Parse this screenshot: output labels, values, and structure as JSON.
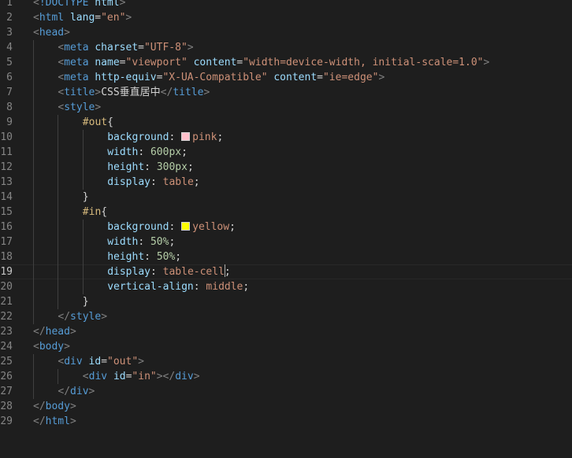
{
  "colors": {
    "background": "#1e1e1e",
    "line_number": "#858585",
    "tag": "#569cd6",
    "attribute": "#9cdcfe",
    "string": "#ce9178",
    "selector": "#d7ba7d",
    "number": "#b5cea8",
    "bracket": "#808080",
    "text": "#d4d4d4"
  },
  "current_line": 19,
  "lines": [
    {
      "n": "1",
      "indent": 0,
      "tokens": [
        {
          "c": "bracket",
          "t": "<"
        },
        {
          "c": "tag",
          "t": "!DOCTYPE"
        },
        {
          "c": "text",
          "t": " "
        },
        {
          "c": "attr",
          "t": "html"
        },
        {
          "c": "bracket",
          "t": ">"
        }
      ]
    },
    {
      "n": "2",
      "indent": 0,
      "tokens": [
        {
          "c": "bracket",
          "t": "<"
        },
        {
          "c": "tag",
          "t": "html"
        },
        {
          "c": "text",
          "t": " "
        },
        {
          "c": "attr",
          "t": "lang"
        },
        {
          "c": "text",
          "t": "="
        },
        {
          "c": "str",
          "t": "\"en\""
        },
        {
          "c": "bracket",
          "t": ">"
        }
      ]
    },
    {
      "n": "3",
      "indent": 0,
      "tokens": [
        {
          "c": "bracket",
          "t": "<"
        },
        {
          "c": "tag",
          "t": "head"
        },
        {
          "c": "bracket",
          "t": ">"
        }
      ]
    },
    {
      "n": "4",
      "indent": 1,
      "tokens": [
        {
          "c": "bracket",
          "t": "<"
        },
        {
          "c": "tag",
          "t": "meta"
        },
        {
          "c": "text",
          "t": " "
        },
        {
          "c": "attr",
          "t": "charset"
        },
        {
          "c": "text",
          "t": "="
        },
        {
          "c": "str",
          "t": "\"UTF-8\""
        },
        {
          "c": "bracket",
          "t": ">"
        }
      ]
    },
    {
      "n": "5",
      "indent": 1,
      "tokens": [
        {
          "c": "bracket",
          "t": "<"
        },
        {
          "c": "tag",
          "t": "meta"
        },
        {
          "c": "text",
          "t": " "
        },
        {
          "c": "attr",
          "t": "name"
        },
        {
          "c": "text",
          "t": "="
        },
        {
          "c": "str",
          "t": "\"viewport\""
        },
        {
          "c": "text",
          "t": " "
        },
        {
          "c": "attr",
          "t": "content"
        },
        {
          "c": "text",
          "t": "="
        },
        {
          "c": "str",
          "t": "\"width=device-width, initial-scale=1.0\""
        },
        {
          "c": "bracket",
          "t": ">"
        }
      ]
    },
    {
      "n": "6",
      "indent": 1,
      "tokens": [
        {
          "c": "bracket",
          "t": "<"
        },
        {
          "c": "tag",
          "t": "meta"
        },
        {
          "c": "text",
          "t": " "
        },
        {
          "c": "attr",
          "t": "http-equiv"
        },
        {
          "c": "text",
          "t": "="
        },
        {
          "c": "str",
          "t": "\"X-UA-Compatible\""
        },
        {
          "c": "text",
          "t": " "
        },
        {
          "c": "attr",
          "t": "content"
        },
        {
          "c": "text",
          "t": "="
        },
        {
          "c": "str",
          "t": "\"ie=edge\""
        },
        {
          "c": "bracket",
          "t": ">"
        }
      ]
    },
    {
      "n": "7",
      "indent": 1,
      "tokens": [
        {
          "c": "bracket",
          "t": "<"
        },
        {
          "c": "tag",
          "t": "title"
        },
        {
          "c": "bracket",
          "t": ">"
        },
        {
          "c": "text",
          "t": "CSS垂直居中"
        },
        {
          "c": "bracket",
          "t": "</"
        },
        {
          "c": "tag",
          "t": "title"
        },
        {
          "c": "bracket",
          "t": ">"
        }
      ]
    },
    {
      "n": "8",
      "indent": 1,
      "tokens": [
        {
          "c": "bracket",
          "t": "<"
        },
        {
          "c": "tag",
          "t": "style"
        },
        {
          "c": "bracket",
          "t": ">"
        }
      ]
    },
    {
      "n": "9",
      "indent": 2,
      "tokens": [
        {
          "c": "sel",
          "t": "#out"
        },
        {
          "c": "punc",
          "t": "{"
        }
      ]
    },
    {
      "n": "10",
      "indent": 3,
      "tokens": [
        {
          "c": "prop",
          "t": "background"
        },
        {
          "c": "punc",
          "t": ": "
        },
        {
          "c": "swatch",
          "t": "",
          "color": "#ffc0cb"
        },
        {
          "c": "val",
          "t": "pink"
        },
        {
          "c": "punc",
          "t": ";"
        }
      ]
    },
    {
      "n": "11",
      "indent": 3,
      "tokens": [
        {
          "c": "prop",
          "t": "width"
        },
        {
          "c": "punc",
          "t": ": "
        },
        {
          "c": "num",
          "t": "600px"
        },
        {
          "c": "punc",
          "t": ";"
        }
      ]
    },
    {
      "n": "12",
      "indent": 3,
      "tokens": [
        {
          "c": "prop",
          "t": "height"
        },
        {
          "c": "punc",
          "t": ": "
        },
        {
          "c": "num",
          "t": "300px"
        },
        {
          "c": "punc",
          "t": ";"
        }
      ]
    },
    {
      "n": "13",
      "indent": 3,
      "tokens": [
        {
          "c": "prop",
          "t": "display"
        },
        {
          "c": "punc",
          "t": ": "
        },
        {
          "c": "val",
          "t": "table"
        },
        {
          "c": "punc",
          "t": ";"
        }
      ]
    },
    {
      "n": "14",
      "indent": 2,
      "tokens": [
        {
          "c": "punc",
          "t": "}"
        }
      ]
    },
    {
      "n": "15",
      "indent": 2,
      "tokens": [
        {
          "c": "sel",
          "t": "#in"
        },
        {
          "c": "punc",
          "t": "{"
        }
      ]
    },
    {
      "n": "16",
      "indent": 3,
      "tokens": [
        {
          "c": "prop",
          "t": "background"
        },
        {
          "c": "punc",
          "t": ": "
        },
        {
          "c": "swatch",
          "t": "",
          "color": "#ffff00"
        },
        {
          "c": "val",
          "t": "yellow"
        },
        {
          "c": "punc",
          "t": ";"
        }
      ]
    },
    {
      "n": "17",
      "indent": 3,
      "tokens": [
        {
          "c": "prop",
          "t": "width"
        },
        {
          "c": "punc",
          "t": ": "
        },
        {
          "c": "num",
          "t": "50%"
        },
        {
          "c": "punc",
          "t": ";"
        }
      ]
    },
    {
      "n": "18",
      "indent": 3,
      "tokens": [
        {
          "c": "prop",
          "t": "height"
        },
        {
          "c": "punc",
          "t": ": "
        },
        {
          "c": "num",
          "t": "50%"
        },
        {
          "c": "punc",
          "t": ";"
        }
      ]
    },
    {
      "n": "19",
      "indent": 3,
      "tokens": [
        {
          "c": "prop",
          "t": "display"
        },
        {
          "c": "punc",
          "t": ": "
        },
        {
          "c": "val",
          "t": "table-cell"
        },
        {
          "c": "cursor",
          "t": ""
        },
        {
          "c": "punc",
          "t": ";"
        }
      ]
    },
    {
      "n": "20",
      "indent": 3,
      "tokens": [
        {
          "c": "prop",
          "t": "vertical-align"
        },
        {
          "c": "punc",
          "t": ": "
        },
        {
          "c": "val",
          "t": "middle"
        },
        {
          "c": "punc",
          "t": ";"
        }
      ]
    },
    {
      "n": "21",
      "indent": 2,
      "tokens": [
        {
          "c": "punc",
          "t": "}"
        }
      ]
    },
    {
      "n": "22",
      "indent": 1,
      "tokens": [
        {
          "c": "bracket",
          "t": "</"
        },
        {
          "c": "tag",
          "t": "style"
        },
        {
          "c": "bracket",
          "t": ">"
        }
      ]
    },
    {
      "n": "23",
      "indent": 0,
      "tokens": [
        {
          "c": "bracket",
          "t": "</"
        },
        {
          "c": "tag",
          "t": "head"
        },
        {
          "c": "bracket",
          "t": ">"
        }
      ]
    },
    {
      "n": "24",
      "indent": 0,
      "tokens": [
        {
          "c": "bracket",
          "t": "<"
        },
        {
          "c": "tag",
          "t": "body"
        },
        {
          "c": "bracket",
          "t": ">"
        }
      ]
    },
    {
      "n": "25",
      "indent": 1,
      "tokens": [
        {
          "c": "bracket",
          "t": "<"
        },
        {
          "c": "tag",
          "t": "div"
        },
        {
          "c": "text",
          "t": " "
        },
        {
          "c": "attr",
          "t": "id"
        },
        {
          "c": "text",
          "t": "="
        },
        {
          "c": "str",
          "t": "\"out\""
        },
        {
          "c": "bracket",
          "t": ">"
        }
      ]
    },
    {
      "n": "26",
      "indent": 2,
      "tokens": [
        {
          "c": "bracket",
          "t": "<"
        },
        {
          "c": "tag",
          "t": "div"
        },
        {
          "c": "text",
          "t": " "
        },
        {
          "c": "attr",
          "t": "id"
        },
        {
          "c": "text",
          "t": "="
        },
        {
          "c": "str",
          "t": "\"in\""
        },
        {
          "c": "bracket",
          "t": "></"
        },
        {
          "c": "tag",
          "t": "div"
        },
        {
          "c": "bracket",
          "t": ">"
        }
      ]
    },
    {
      "n": "27",
      "indent": 1,
      "tokens": [
        {
          "c": "bracket",
          "t": "</"
        },
        {
          "c": "tag",
          "t": "div"
        },
        {
          "c": "bracket",
          "t": ">"
        }
      ]
    },
    {
      "n": "28",
      "indent": 0,
      "tokens": [
        {
          "c": "bracket",
          "t": "</"
        },
        {
          "c": "tag",
          "t": "body"
        },
        {
          "c": "bracket",
          "t": ">"
        }
      ]
    },
    {
      "n": "29",
      "indent": 0,
      "tokens": [
        {
          "c": "bracket",
          "t": "</"
        },
        {
          "c": "tag",
          "t": "html"
        },
        {
          "c": "bracket",
          "t": ">"
        }
      ]
    }
  ]
}
